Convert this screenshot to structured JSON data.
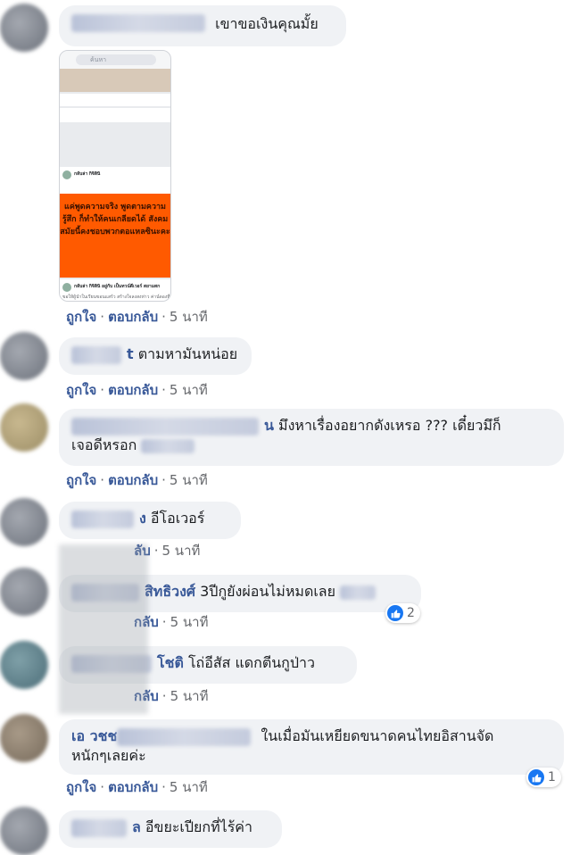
{
  "comments": [
    {
      "id": "c1",
      "text": "เขาขอเงินคุณมั้ย",
      "actions": null
    },
    {
      "id": "c1-image",
      "image": {
        "search_placeholder": "ค้นหา",
        "post_name": "กลับล่า กิจิสินิ",
        "post_text": "แค่พูดความจริง พูดตามความรู้สึก ก็ทำให้คนเกลียดได้ สังคมสมัยนี้คงชอบพวกตอแหลซินะคะ",
        "post2_name": "กลับล่า กิจิสินิ อยู่กับ เป็นทวน์ดีเวอร์ สยามสก",
        "post2_text": "ขอให้ผู้นำในเรียนขอนแสร้ว สร้างใจลงสงห่าว ค่าน์ดองที่"
      },
      "actions": {
        "like": "ถูกใจ",
        "reply": "ตอบกลับ",
        "time": "5 นาที"
      }
    },
    {
      "id": "c2",
      "name_suffix": "t",
      "text": "ตามหามันหน่อย",
      "actions": {
        "like": "ถูกใจ",
        "reply": "ตอบกลับ",
        "time": "5 นาที"
      }
    },
    {
      "id": "c3",
      "name_suffix": "น",
      "text_line1": "มึงหาเรื่องอยากดังเหรอ ??? เดี๋ยวมึ",
      "text_line1_end": "ก็",
      "text_line2": "เจอดีหรอก",
      "actions": {
        "like": "ถูกใจ",
        "reply": "ตอบกลับ",
        "time": "5 นาที"
      }
    },
    {
      "id": "c4",
      "name_suffix": "ง",
      "text": "อีโอเวอร์",
      "actions": {
        "like_partial": "ลับ",
        "time": "5 นาที",
        "reply_partial": "กลับ"
      }
    },
    {
      "id": "c5",
      "name_suffix": "สิทธิวงศ์",
      "text": "3ปีกูยังผ่อนไม่หมดเลย",
      "reaction_count": "2",
      "actions": {
        "reply_partial": "กลับ",
        "time": "5 นาที"
      }
    },
    {
      "id": "c6",
      "name_suffix": "โชติ",
      "text": "โถ่อีสัส แดกตีนกูป่าว",
      "actions": {
        "reply_partial": "กลับ",
        "time": "5 นาที"
      }
    },
    {
      "id": "c7",
      "name_prefix": "เอ วชช",
      "text_line1": "ในเมื่อมันเหยียดขนาดคนไทยอิสานจัด",
      "text_line2": "หนักๆเลยค่ะ",
      "reaction_count": "1",
      "actions": {
        "like": "ถูกใจ",
        "reply": "ตอบกลับ",
        "time": "5 นาที"
      }
    },
    {
      "id": "c8",
      "name_suffix": "ล",
      "text": "อีขยะเปียกที่ไร้ค่า"
    }
  ],
  "colors": {
    "link": "#385898",
    "bubble": "#f0f2f5",
    "like_blue": "#1877f2",
    "orange": "#ff5a00"
  }
}
